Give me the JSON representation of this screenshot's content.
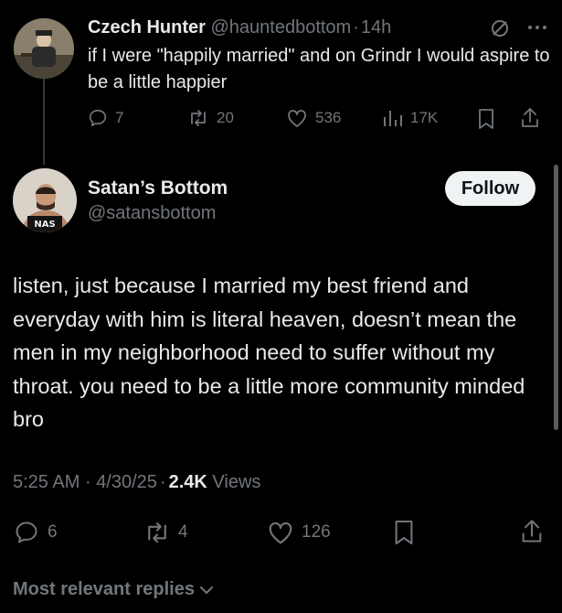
{
  "reply_tweet": {
    "display_name": "Czech Hunter",
    "handle": "@hauntedbottom",
    "separator": "·",
    "time": "14h",
    "text": "if I were \"happily married\" and on Grindr I would aspire to be a little happier",
    "stats": {
      "replies": "7",
      "reposts": "20",
      "likes": "536",
      "views": "17K"
    }
  },
  "main_tweet": {
    "display_name": "Satan’s Bottom",
    "handle": "@satansbottom",
    "follow_label": "Follow",
    "avatar_text": "NAS",
    "text": "listen, just because I married my best friend and everyday with him is literal heaven, doesn’t mean the men in my neighborhood need to suffer without my throat. you need to be a little more community minded bro",
    "meta": {
      "time": "5:25 AM",
      "sep1": "·",
      "date": "4/30/25",
      "sep2": "·",
      "views_count": "2.4K",
      "views_label": "Views"
    },
    "stats": {
      "replies": "6",
      "reposts": "4",
      "likes": "126"
    }
  },
  "replies_sort": {
    "label": "Most relevant replies"
  },
  "colors": {
    "background": "#000000",
    "text": "#e7e9ea",
    "muted": "#71767b",
    "button": "#eff3f4"
  }
}
